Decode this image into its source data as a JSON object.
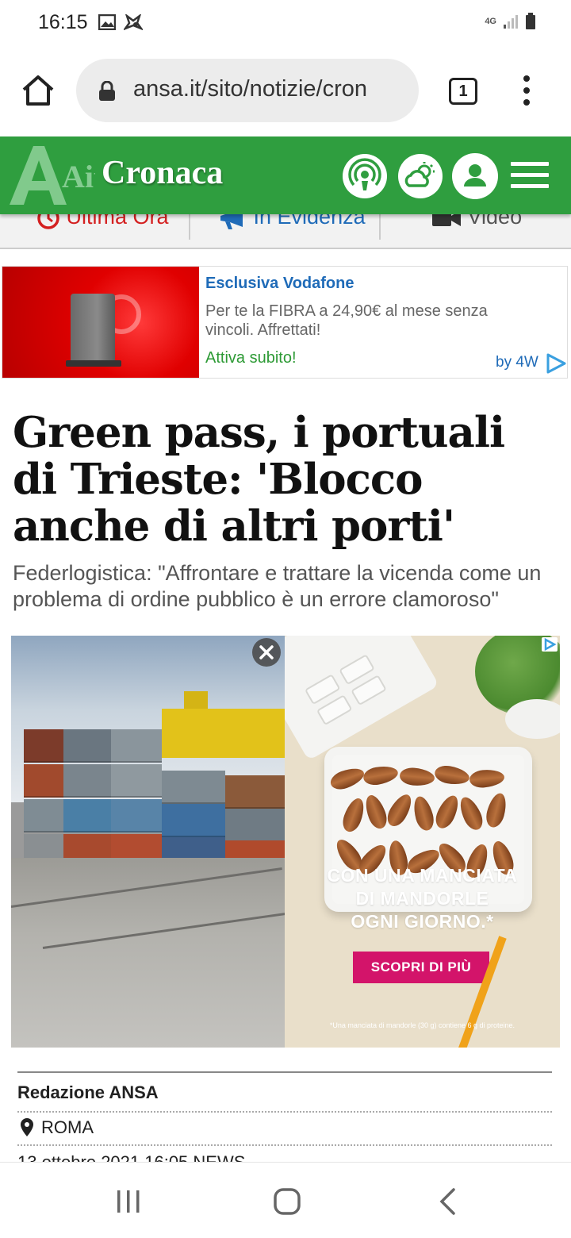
{
  "status_bar": {
    "time": "16:15",
    "network": "4G"
  },
  "browser": {
    "url": "ansa.it/sito/notizie/cron",
    "tab_count": "1"
  },
  "site_header": {
    "logo_text": "Ait",
    "section_title": "Cronaca"
  },
  "nav_tabs": [
    {
      "label": "Ultima Ora",
      "icon": "clock-icon"
    },
    {
      "label": "In Evidenza",
      "icon": "megaphone-icon"
    },
    {
      "label": "Video",
      "icon": "video-camera-icon"
    }
  ],
  "ad": {
    "title": "Esclusiva Vodafone",
    "description": "Per te la FIBRA a 24,90€ al mese senza vincoli. Affrettati!",
    "cta": "Attiva subito!",
    "by": "by 4W"
  },
  "article": {
    "headline": "Green pass, i portuali di Trieste: 'Blocco anche di altri porti'",
    "subheadline": "Federlogistica: \"Affrontare e trattare la vicenda come un problema di ordine pubblico è un errore clamoroso\""
  },
  "image_ad": {
    "text_line1": "CON UNA MANCIATA",
    "text_line2": "DI MANDORLE",
    "text_line3": "OGNI GIORNO.*",
    "button": "SCOPRI DI PIÙ",
    "footnote": "*Una manciata di mandorle (30 g) contiene 6 g di proteine."
  },
  "meta": {
    "author": "Redazione ANSA",
    "location": "ROMA",
    "date_line": "13 ottobre 2021   16:05     NEWS"
  },
  "colors": {
    "ansa_green": "#2f9e3f",
    "ad_link_blue": "#1f6bb8",
    "vodafone_red": "#e00000",
    "cta_green": "#2d9a35",
    "ad_button_magenta": "#d3146a"
  }
}
